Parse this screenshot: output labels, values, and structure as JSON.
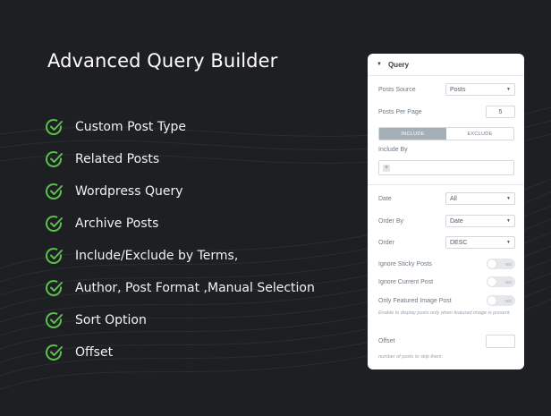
{
  "title": "Advanced Query Builder",
  "colors": {
    "background": "#1d1f22",
    "check": "#59c24a",
    "panel": "#ffffff"
  },
  "features": [
    "Custom Post Type",
    "Related Posts",
    "Wordpress Query",
    "Archive Posts",
    "Include/Exclude by Terms,",
    "Author, Post Format ,Manual Selection",
    "Sort Option",
    "Offset"
  ],
  "panel": {
    "section_title": "Query",
    "posts_source": {
      "label": "Posts Source",
      "value": "Posts"
    },
    "posts_per_page": {
      "label": "Posts Per Page",
      "value": "5"
    },
    "tabs": {
      "include": "INCLUDE",
      "exclude": "EXCLUDE"
    },
    "include_by": {
      "label": "Include By"
    },
    "date": {
      "label": "Date",
      "value": "All"
    },
    "order_by": {
      "label": "Order By",
      "value": "Date"
    },
    "order": {
      "label": "Order",
      "value": "DESC"
    },
    "ignore_sticky": {
      "label": "Ignore Sticky Posts",
      "toggle": "NO"
    },
    "ignore_current": {
      "label": "Ignore Current Post",
      "toggle": "NO"
    },
    "only_featured": {
      "label": "Only Featured Image Post",
      "toggle": "NO"
    },
    "featured_note": "Enable to display posts only when featured image is present.",
    "offset": {
      "label": "Offset",
      "note": "number of posts to skip them."
    }
  }
}
